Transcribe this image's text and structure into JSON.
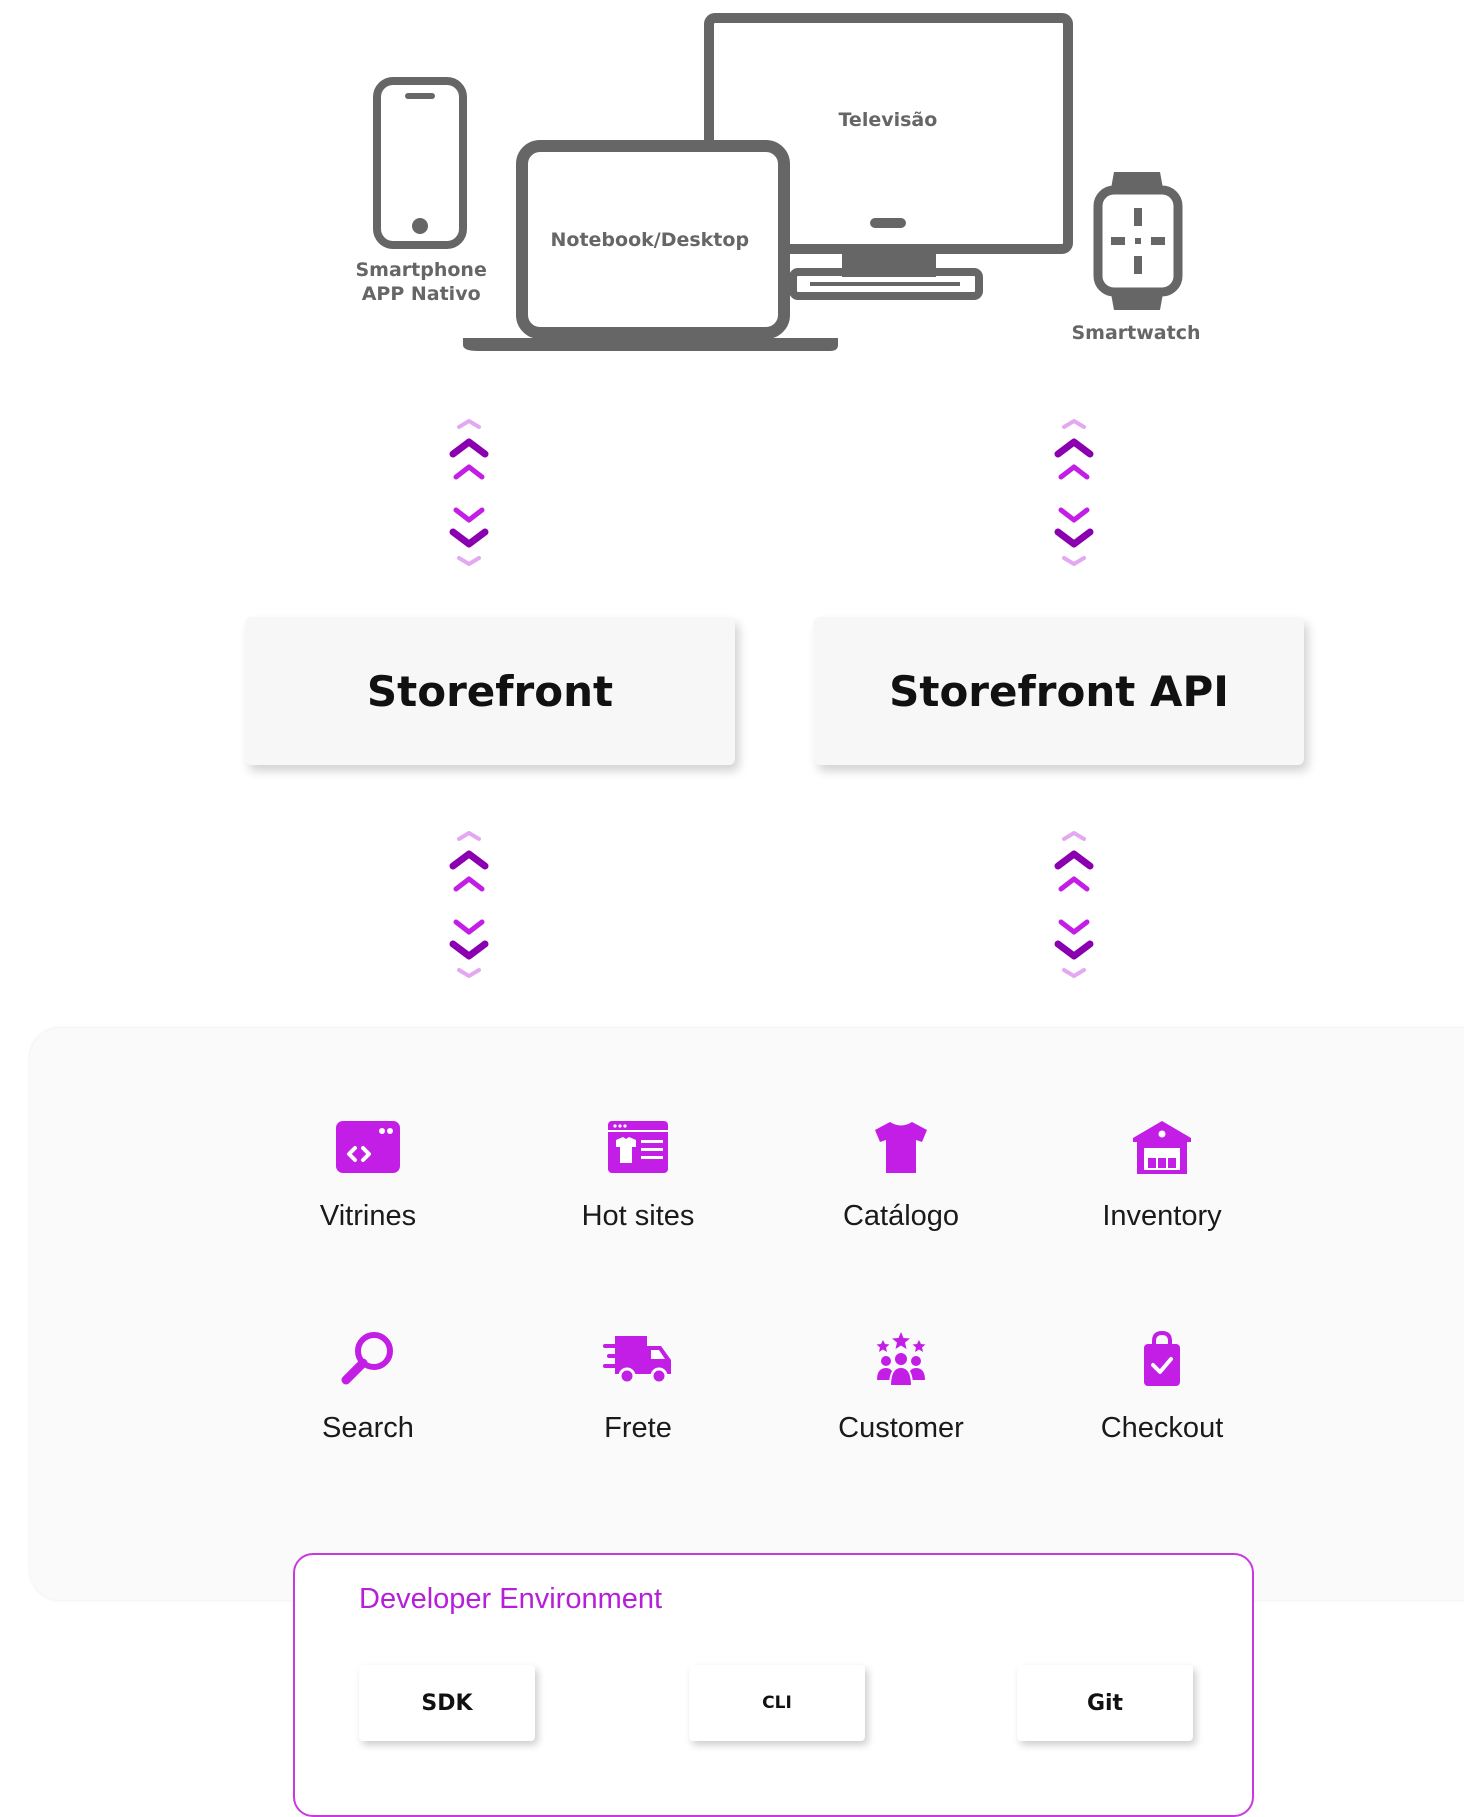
{
  "devices": {
    "smartphone_line1": "Smartphone",
    "smartphone_line2": "APP Nativo",
    "notebook": "Notebook/Desktop",
    "television": "Televisão",
    "smartwatch": "Smartwatch"
  },
  "layers": {
    "storefront": "Storefront",
    "storefront_api": "Storefront API"
  },
  "modules": [
    {
      "label": "Vitrines",
      "icon": "browser-code-icon"
    },
    {
      "label": "Hot sites",
      "icon": "webpage-shirt-icon"
    },
    {
      "label": "Catálogo",
      "icon": "tshirt-icon"
    },
    {
      "label": "Inventory",
      "icon": "warehouse-icon"
    },
    {
      "label": "Search",
      "icon": "magnifier-icon"
    },
    {
      "label": "Frete",
      "icon": "delivery-truck-icon"
    },
    {
      "label": "Customer",
      "icon": "customers-stars-icon"
    },
    {
      "label": "Checkout",
      "icon": "shopping-bag-check-icon"
    }
  ],
  "developer_environment": {
    "title": "Developer Environment",
    "tools": [
      "SDK",
      "CLI",
      "Git"
    ]
  },
  "colors": {
    "accent": "#c21ee6",
    "accent_dark": "#8a00b0",
    "accent_light": "#e4a8f2",
    "device_gray": "#666666"
  }
}
